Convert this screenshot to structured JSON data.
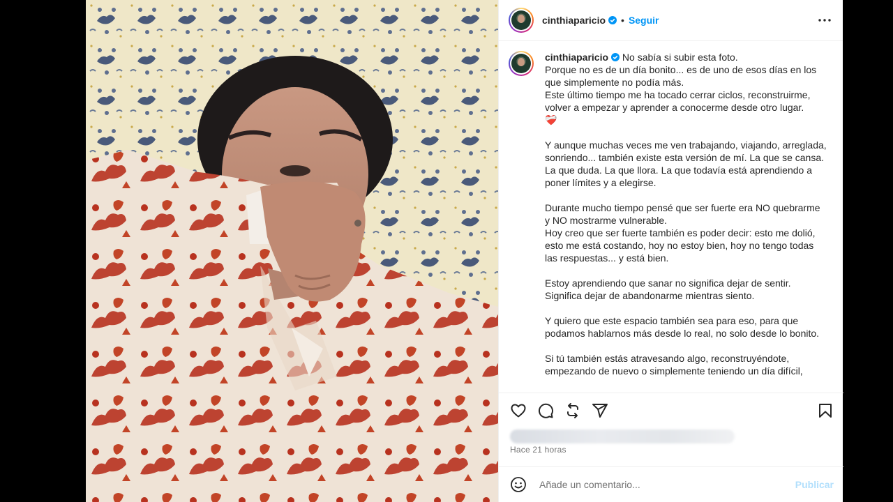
{
  "post": {
    "username": "cinthiaparicio",
    "separator": "•",
    "follow_label": "Seguir",
    "more_icon": "more-options-icon",
    "verified_color": "#0095f6",
    "caption": {
      "username": "cinthiaparicio",
      "first_line": "No sabía si subir esta foto.",
      "p1": "Porque no es de un día bonito... es de uno de esos días en los que simplemente no podía más.\nEste último tiempo me ha tocado cerrar ciclos, reconstruirme, volver a empezar y aprender a conocerme desde otro lugar.",
      "p1_emoji": "❤️‍🩹",
      "p2": "Y aunque muchas veces me ven trabajando, viajando, arreglada, sonriendo... también existe esta versión de mí. La que se cansa. La que duda. La que llora. La que todavía está aprendiendo a poner límites y a elegirse.",
      "p3": "Durante mucho tiempo pensé que ser fuerte era NO quebrarme y NO mostrarme vulnerable.\nHoy creo que ser fuerte también es poder decir: esto me dolió, esto me está costando, hoy no estoy bien, hoy no tengo todas las respuestas... y está bien.",
      "p4": "Estoy aprendiendo que sanar no significa dejar de sentir.\nSignifica dejar de abandonarme mientras siento.",
      "p5": "Y quiero que este espacio también sea para eso, para que podamos hablarnos más desde lo real, no solo desde lo bonito.",
      "p6": "Si tú también estás atravesando algo, reconstruyéndote, empezando de nuevo o simplemente teniendo un día difícil,"
    },
    "actions": [
      "heart-icon",
      "comment-icon",
      "repost-icon",
      "share-icon",
      "bookmark-icon"
    ],
    "time_label": "Hace 21 horas",
    "comment_placeholder": "Añade un comentario...",
    "publish_label": "Publicar",
    "publish_color": "#b2dffc"
  }
}
